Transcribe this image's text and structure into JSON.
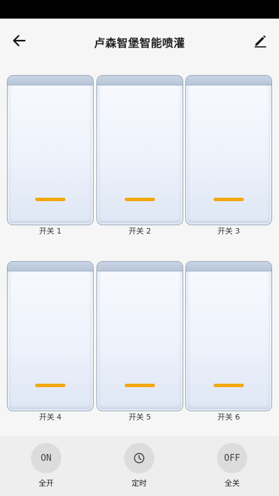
{
  "header": {
    "title": "卢森智堡智能喷灌"
  },
  "switches": [
    {
      "label": "开关 1"
    },
    {
      "label": "开关 2"
    },
    {
      "label": "开关 3"
    },
    {
      "label": "开关 4"
    },
    {
      "label": "开关 5"
    },
    {
      "label": "开关 6"
    }
  ],
  "bottom_bar": {
    "all_on": {
      "icon_text": "ON",
      "label": "全开"
    },
    "timer": {
      "icon": "clock-icon",
      "label": "定时"
    },
    "all_off": {
      "icon_text": "OFF",
      "label": "全关"
    }
  },
  "colors": {
    "indicator": "#f2a80e",
    "background": "#f6f6f6",
    "bottom_bar": "#eeeeee"
  }
}
